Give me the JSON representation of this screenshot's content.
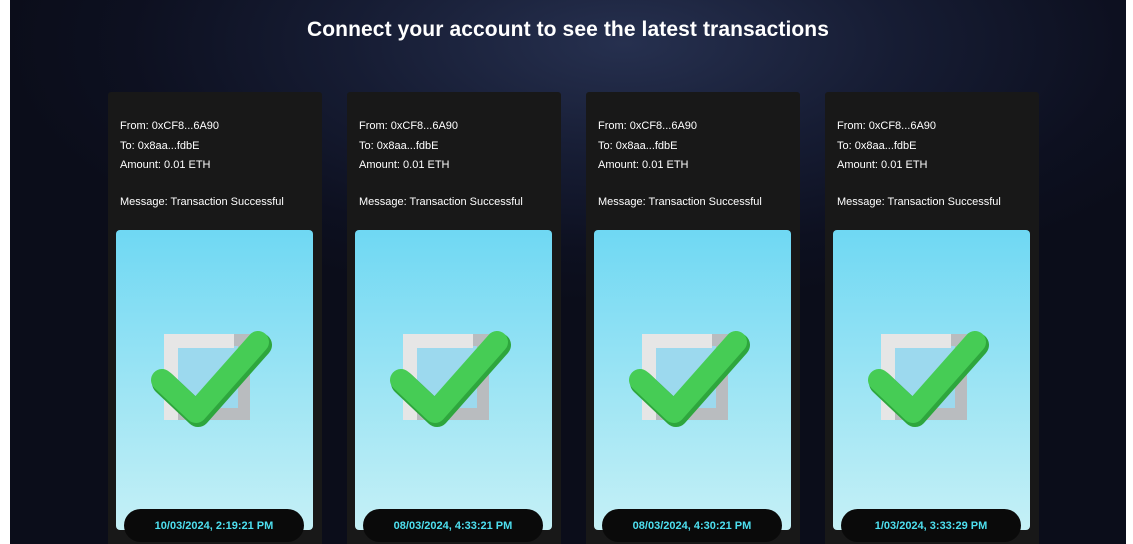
{
  "header": {
    "title": "Connect your account to see the latest transactions"
  },
  "colors": {
    "accent": "#4ee0f0",
    "card_bg": "#181818",
    "page_bg": "#0d1020",
    "check_green": "#3ac54c"
  },
  "transactions": [
    {
      "from": "From: 0xCF8...6A90",
      "to": "To: 0x8aa...fdbE",
      "amount": "Amount: 0.01 ETH",
      "message": "Message: Transaction Successful",
      "image_icon": "checkmark-box-icon",
      "timestamp": "10/03/2024, 2:19:21 PM"
    },
    {
      "from": "From: 0xCF8...6A90",
      "to": "To: 0x8aa...fdbE",
      "amount": "Amount: 0.01 ETH",
      "message": "Message: Transaction Successful",
      "image_icon": "checkmark-box-icon",
      "timestamp": "08/03/2024, 4:33:21 PM"
    },
    {
      "from": "From: 0xCF8...6A90",
      "to": "To: 0x8aa...fdbE",
      "amount": "Amount: 0.01 ETH",
      "message": "Message: Transaction Successful",
      "image_icon": "checkmark-box-icon",
      "timestamp": "08/03/2024, 4:30:21 PM"
    },
    {
      "from": "From: 0xCF8...6A90",
      "to": "To: 0x8aa...fdbE",
      "amount": "Amount: 0.01 ETH",
      "message": "Message: Transaction Successful",
      "image_icon": "checkmark-box-icon",
      "timestamp": "1/03/2024, 3:33:29 PM"
    }
  ]
}
